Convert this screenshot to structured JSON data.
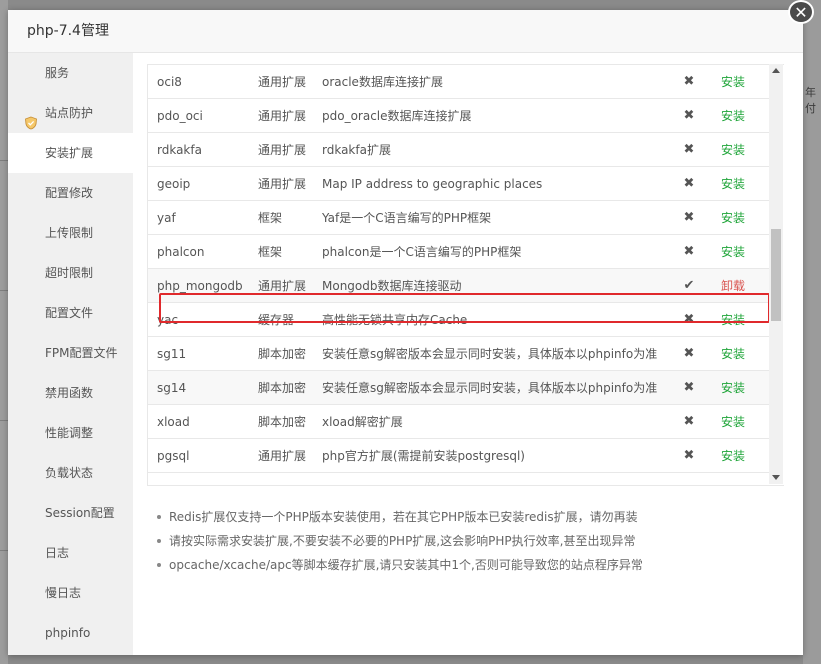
{
  "dialog": {
    "title": "php-7.4管理",
    "close_symbol": "✕"
  },
  "sidebar": {
    "items": [
      {
        "label": "服务"
      },
      {
        "label": "站点防护",
        "icon": "shield-icon"
      },
      {
        "label": "安装扩展",
        "active": true
      },
      {
        "label": "配置修改"
      },
      {
        "label": "上传限制"
      },
      {
        "label": "超时限制"
      },
      {
        "label": "配置文件"
      },
      {
        "label": "FPM配置文件"
      },
      {
        "label": "禁用函数"
      },
      {
        "label": "性能调整"
      },
      {
        "label": "负载状态"
      },
      {
        "label": "Session配置"
      },
      {
        "label": "日志"
      },
      {
        "label": "慢日志"
      },
      {
        "label": "phpinfo"
      }
    ]
  },
  "extensions": {
    "rows": [
      {
        "name": "oci8",
        "type": "通用扩展",
        "desc": "oracle数据库连接扩展",
        "status": "✖",
        "action": "安装"
      },
      {
        "name": "pdo_oci",
        "type": "通用扩展",
        "desc": "pdo_oracle数据库连接扩展",
        "status": "✖",
        "action": "安装"
      },
      {
        "name": "rdkakfa",
        "type": "通用扩展",
        "desc": "rdkakfa扩展",
        "status": "✖",
        "action": "安装"
      },
      {
        "name": "geoip",
        "type": "通用扩展",
        "desc": "Map IP address to geographic places",
        "status": "✖",
        "action": "安装"
      },
      {
        "name": "yaf",
        "type": "框架",
        "desc": "Yaf是一个C语言编写的PHP框架",
        "status": "✖",
        "action": "安装"
      },
      {
        "name": "phalcon",
        "type": "框架",
        "desc": "phalcon是一个C语言编写的PHP框架",
        "status": "✖",
        "action": "安装"
      },
      {
        "name": "php_mongodb",
        "type": "通用扩展",
        "desc": "Mongodb数据库连接驱动",
        "status": "✔",
        "action": "卸载"
      },
      {
        "name": "yac",
        "type": "缓存器",
        "desc": "高性能无锁共享内存Cache",
        "status": "✖",
        "action": "安装"
      },
      {
        "name": "sg11",
        "type": "脚本加密",
        "desc": "安装任意sg解密版本会显示同时安装，具体版本以phpinfo为准",
        "status": "✖",
        "action": "安装"
      },
      {
        "name": "sg14",
        "type": "脚本加密",
        "desc": "安装任意sg解密版本会显示同时安装，具体版本以phpinfo为准",
        "status": "✖",
        "action": "安装"
      },
      {
        "name": "xload",
        "type": "脚本加密",
        "desc": "xload解密扩展",
        "status": "✖",
        "action": "安装"
      },
      {
        "name": "pgsql",
        "type": "通用扩展",
        "desc": "php官方扩展(需提前安装postgresql)",
        "status": "✖",
        "action": "安装"
      }
    ]
  },
  "notes": [
    "Redis扩展仅支持一个PHP版本安装使用，若在其它PHP版本已安装redis扩展，请勿再装",
    "请按实际需求安装扩展,不要安装不必要的PHP扩展,这会影响PHP执行效率,甚至出现异常",
    "opcache/xcache/apc等脚本缓存扩展,请只安装其中1个,否则可能导致您的站点程序异常"
  ],
  "background": {
    "right_fragment": "年付"
  },
  "colors": {
    "install": "#20a53a",
    "uninstall": "#d9534f",
    "highlight": "#e0292c"
  }
}
